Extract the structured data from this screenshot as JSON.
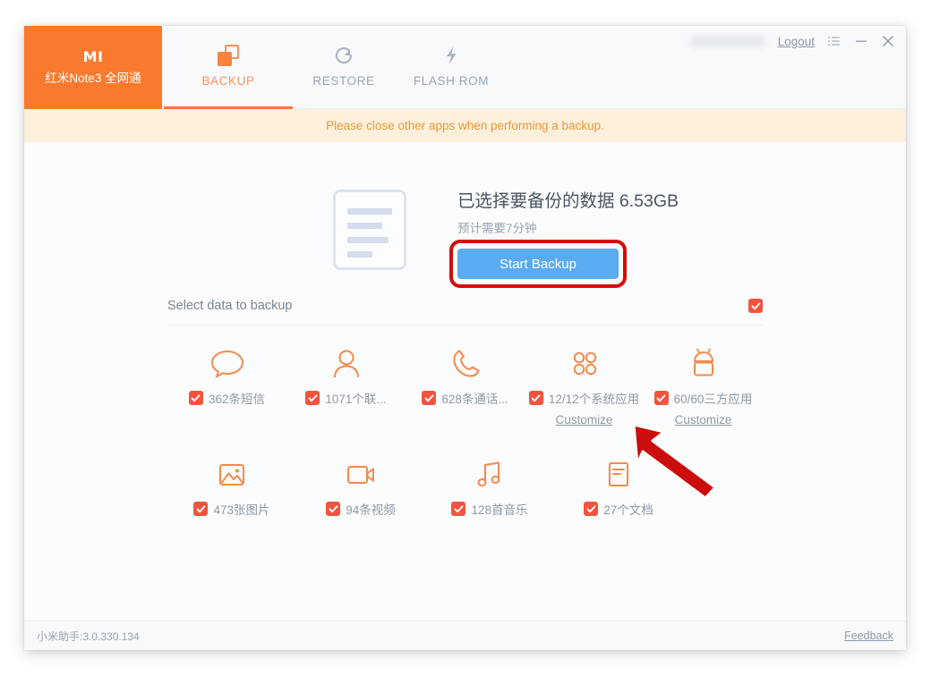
{
  "window": {
    "titlebar": {
      "username_redacted": "",
      "logout_label": "Logout",
      "menu_icon": "list-menu-icon",
      "minimize_icon": "minimize-icon",
      "close_icon": "close-icon"
    },
    "brand": {
      "logo_text": "MI",
      "device_model": "红米Note3 全网通",
      "background_color": "#f97a2e"
    },
    "tabs": [
      {
        "id": "backup",
        "label": "BACKUP",
        "icon": "backup-copy-icon",
        "active": true
      },
      {
        "id": "restore",
        "label": "RESTORE",
        "icon": "restore-refresh-icon",
        "active": false
      },
      {
        "id": "flash",
        "label": "FLASH ROM",
        "icon": "lightning-bolt-icon",
        "active": false
      }
    ],
    "notice": {
      "text": "Please close other apps when performing a backup.",
      "background_color": "#fcefdb",
      "text_color": "#e79b3c"
    }
  },
  "summary": {
    "illustration_icon": "document-lines-icon",
    "title": "已选择要备份的数据 6.53GB",
    "size_value": "6.53GB",
    "subtitle": "预计需要7分钟",
    "start_button_label": "Start Backup",
    "start_button_color": "#5aabf0",
    "annotation": {
      "highlight_color": "#d60a0a",
      "box_target": "start-backup-button",
      "arrow": "red-pointer-arrow"
    }
  },
  "select_section": {
    "title": "Select data to backup",
    "select_all_checked": true,
    "checkbox_color": "#f4533d",
    "rows": [
      [
        {
          "icon": "sms-bubble-icon",
          "label": "362条短信",
          "checked": true,
          "customize": null
        },
        {
          "icon": "contact-person-icon",
          "label": "1071个联...",
          "checked": true,
          "customize": null
        },
        {
          "icon": "phone-call-icon",
          "label": "628条通话...",
          "checked": true,
          "customize": null
        },
        {
          "icon": "system-apps-grid-icon",
          "label": "12/12个系统应用",
          "checked": true,
          "customize": "Customize"
        },
        {
          "icon": "android-robot-icon",
          "label": "60/60三方应用",
          "checked": true,
          "customize": "Customize"
        }
      ],
      [
        {
          "icon": "image-photo-icon",
          "label": "473张图片",
          "checked": true,
          "customize": null
        },
        {
          "icon": "video-camera-icon",
          "label": "94条视频",
          "checked": true,
          "customize": null
        },
        {
          "icon": "music-note-icon",
          "label": "128首音乐",
          "checked": true,
          "customize": null
        },
        {
          "icon": "document-file-icon",
          "label": "27个文档",
          "checked": true,
          "customize": null
        }
      ]
    ]
  },
  "footer": {
    "version": "小米助手:3.0.330.134",
    "feedback_label": "Feedback"
  }
}
